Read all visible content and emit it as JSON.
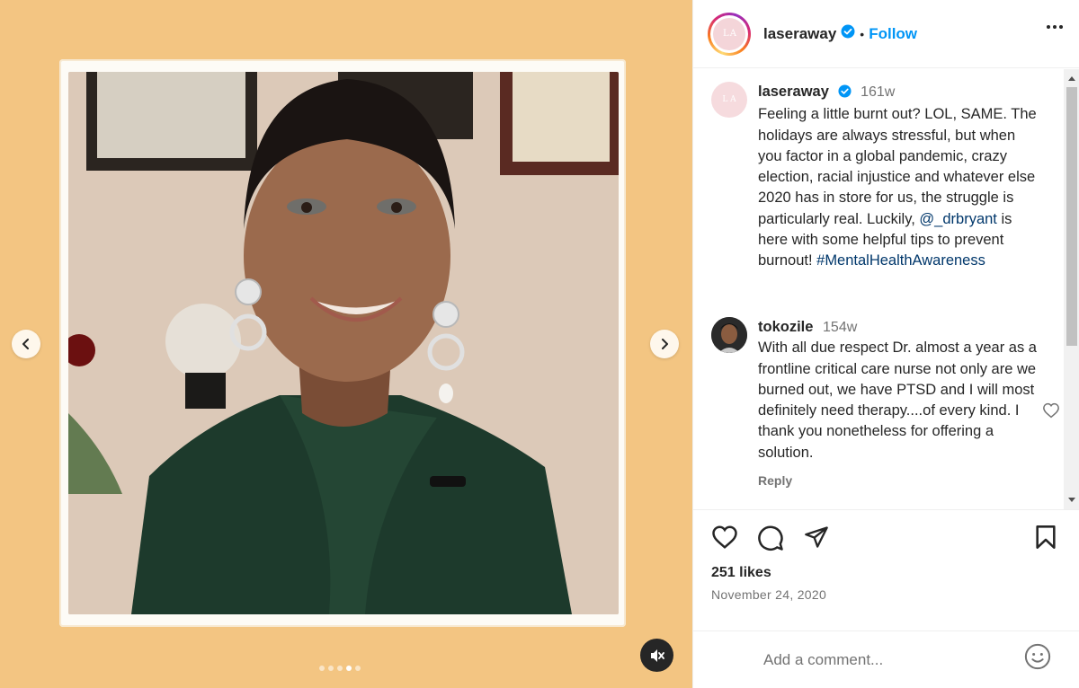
{
  "post": {
    "username": "laseraway",
    "follow_label": "Follow",
    "separator": "•",
    "avatar_text": "L A",
    "likes": "251 likes",
    "date": "November 24, 2020"
  },
  "caption": {
    "username": "laseraway",
    "age": "161w",
    "text_before": "Feeling a little burnt out? LOL, SAME. The holidays are always stressful, but when you factor in a global pandemic, crazy election, racial injustice and whatever else 2020 has in store for us, the struggle is particularly real. Luckily, ",
    "mention": "@_drbryant",
    "text_after": " is here with some helpful tips to prevent burnout! ",
    "hashtag": "#MentalHealthAwareness"
  },
  "comment": {
    "username": "tokozile",
    "age": "154w",
    "text": "With all due respect Dr. almost a year as a frontline critical care nurse not only are we burned out, we have PTSD and I will most definitely need therapy....of every kind. I thank you nonetheless for offering a solution.",
    "reply_label": "Reply"
  },
  "composer": {
    "placeholder": "Add a comment..."
  },
  "carousel": {
    "slide_count": 5,
    "active_index": 3
  },
  "colors": {
    "media_background": "#f3c582",
    "link_blue": "#0095f6",
    "verified_blue": "#0095f6"
  },
  "icons": [
    "chevron-left-icon",
    "chevron-right-icon",
    "mute-icon",
    "verified-icon",
    "more-icon",
    "heart-icon",
    "comment-icon",
    "share-icon",
    "bookmark-icon",
    "emoji-icon"
  ]
}
